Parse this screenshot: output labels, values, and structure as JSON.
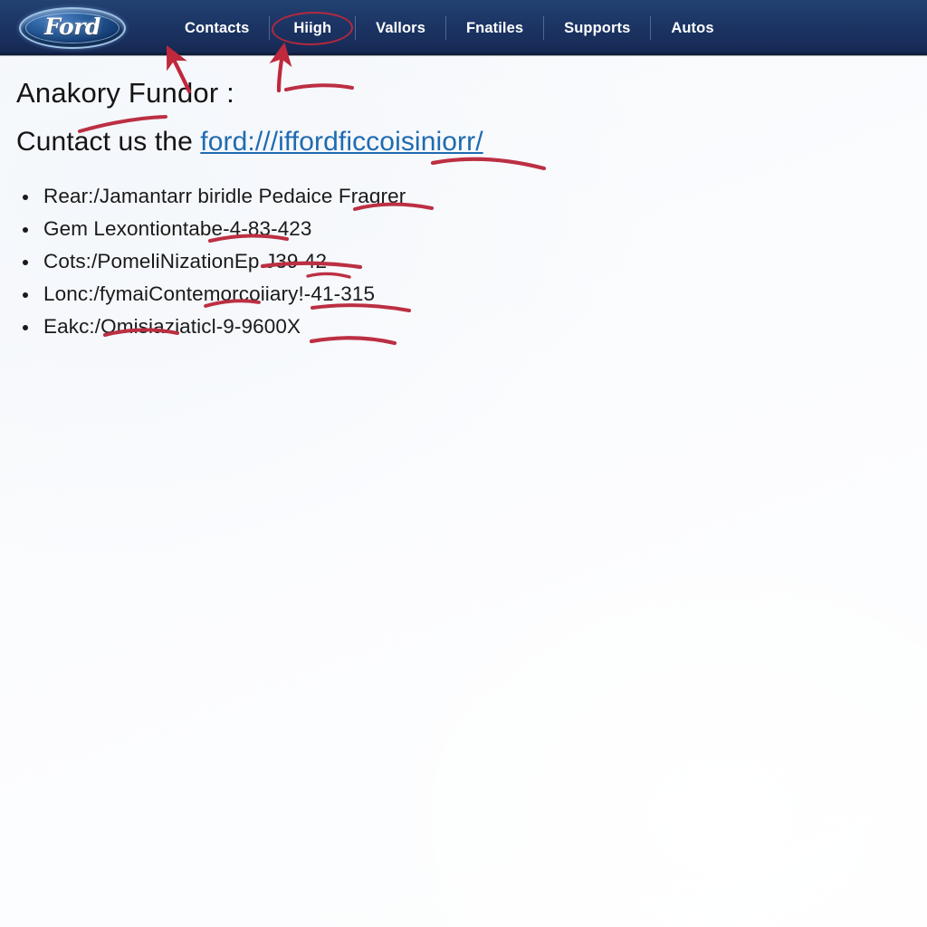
{
  "theme": {
    "nav_bg_top": "#234272",
    "nav_bg_bottom": "#152750",
    "nav_text": "#ffffff",
    "page_bg": "#fbfcfe",
    "body_text": "#141414",
    "link_color": "#1f6bb0",
    "annotation_red": "#c0283c",
    "logo_blue": "#17417a"
  },
  "navbar": {
    "logo": {
      "name": "ford-logo",
      "wordmark": "Ford"
    },
    "items": [
      {
        "label": "Contacts",
        "circled": false
      },
      {
        "label": "Hiigh",
        "circled": true
      },
      {
        "label": "Vallors",
        "circled": false
      },
      {
        "label": "Fnatiles",
        "circled": false
      },
      {
        "label": "Supports",
        "circled": false
      },
      {
        "label": "Autos",
        "circled": false
      }
    ]
  },
  "content": {
    "heading": "Anakory Fundor :",
    "subheading_prefix": "Cuntact us the ",
    "link_text": "ford:///iffordficcoisiniorr/",
    "bullets": [
      "Rear:/Jamantarr biridle Pedaice Fragrer",
      "Gem Lexontiontabe-4-83-423",
      "Cots:/PomeliNizationEp.J39 42",
      "Lonc:/fymaiContemorcoiiary!-41-315",
      "Eakc:/Omisiaziaticl-9-9600X"
    ]
  },
  "annotations": {
    "arrows": [
      {
        "name": "arrow-to-contacts",
        "target": "Contacts"
      },
      {
        "name": "arrow-to-hiigh",
        "target": "Hiigh"
      }
    ],
    "ellipses": [
      {
        "name": "ellipse-around-hiigh",
        "target": "Hiigh"
      }
    ],
    "underline_count": 9,
    "color": "#c0283c"
  }
}
